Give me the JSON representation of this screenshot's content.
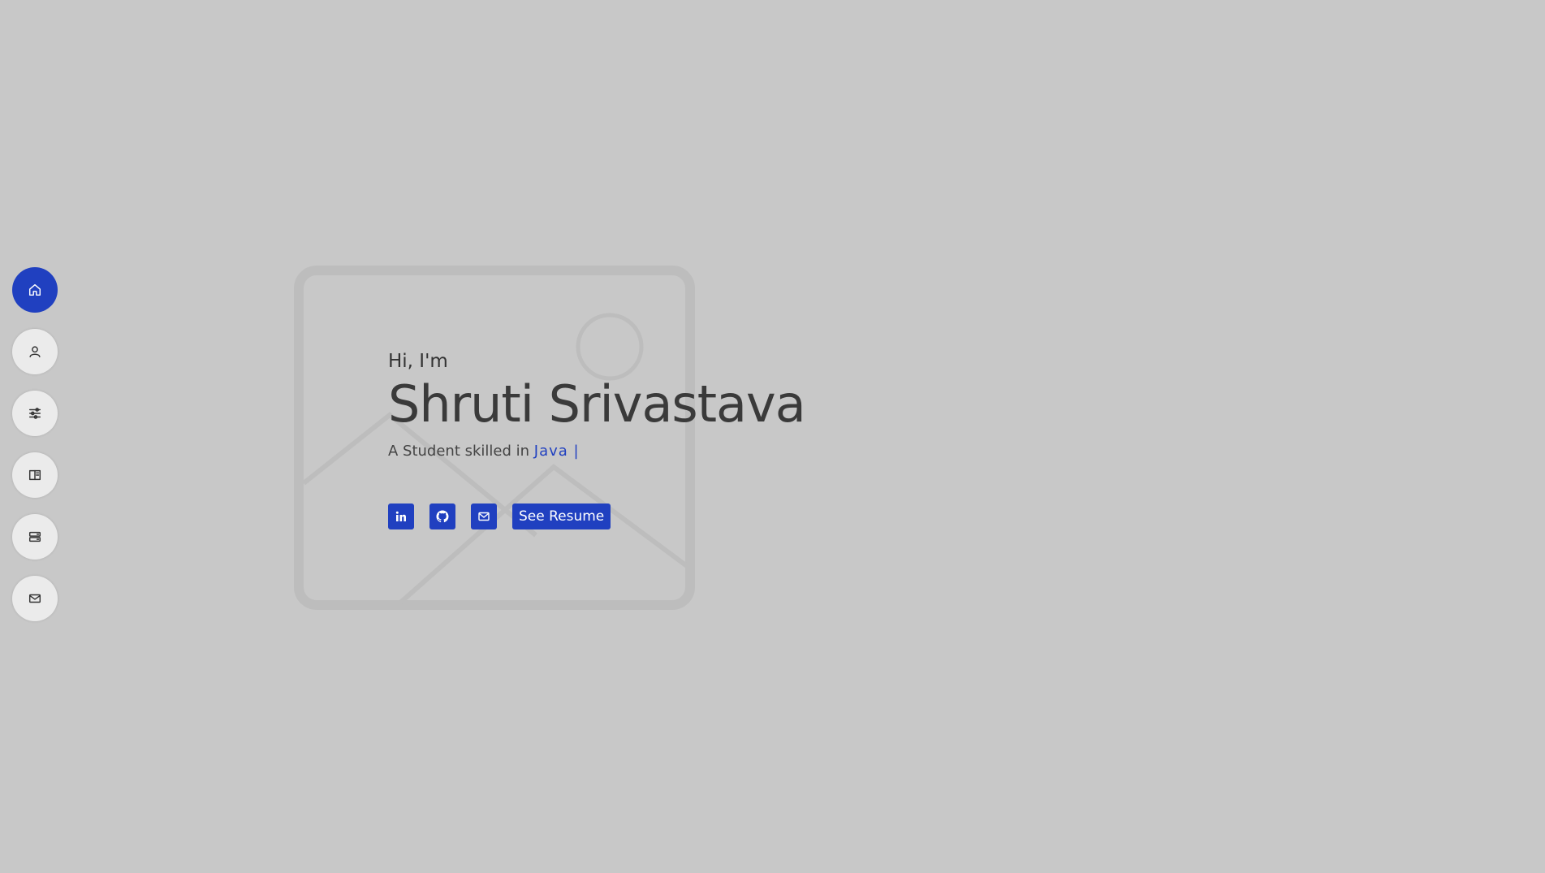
{
  "nav": {
    "items": [
      {
        "icon": "home-icon",
        "active": true
      },
      {
        "icon": "user-icon",
        "active": false
      },
      {
        "icon": "sliders-icon",
        "active": false
      },
      {
        "icon": "book-icon",
        "active": false
      },
      {
        "icon": "server-icon",
        "active": false
      },
      {
        "icon": "envelope-icon",
        "active": false
      }
    ]
  },
  "hero": {
    "greeting": "Hi, I'm",
    "name": "Shruti Srivastava",
    "tagline_prefix": "A Student skilled in ",
    "tagline_skill": "Java |",
    "social": [
      {
        "icon": "linkedin-icon"
      },
      {
        "icon": "github-icon"
      },
      {
        "icon": "envelope-icon"
      }
    ],
    "resume_label": "See Resume"
  },
  "colors": {
    "background": "#c8c8c8",
    "accent": "#2040c0",
    "text": "#333333"
  }
}
